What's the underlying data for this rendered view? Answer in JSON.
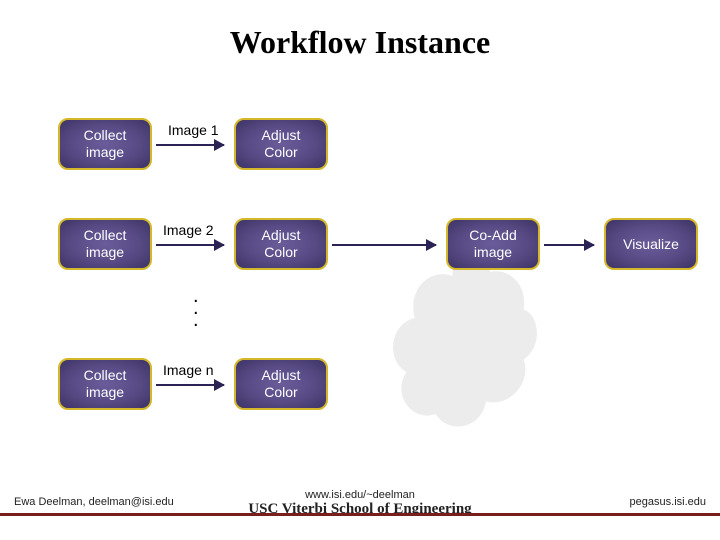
{
  "title": "Workflow Instance",
  "nodes": {
    "collect1": "Collect\nimage",
    "collect2": "Collect\nimage",
    "collect3": "Collect\nimage",
    "adjust1": "Adjust\nColor",
    "adjust2": "Adjust\nColor",
    "adjust3": "Adjust\nColor",
    "coadd": "Co-Add\nimage",
    "viz": "Visualize"
  },
  "labels": {
    "img1": "Image 1",
    "img2": "Image 2",
    "imgn": "Image n"
  },
  "footer": {
    "left": "Ewa Deelman, deelman@isi.edu",
    "center_url": "www.isi.edu/~deelman",
    "center_school": "USC Viterbi School of Engineering",
    "right": "pegasus.isi.edu"
  }
}
